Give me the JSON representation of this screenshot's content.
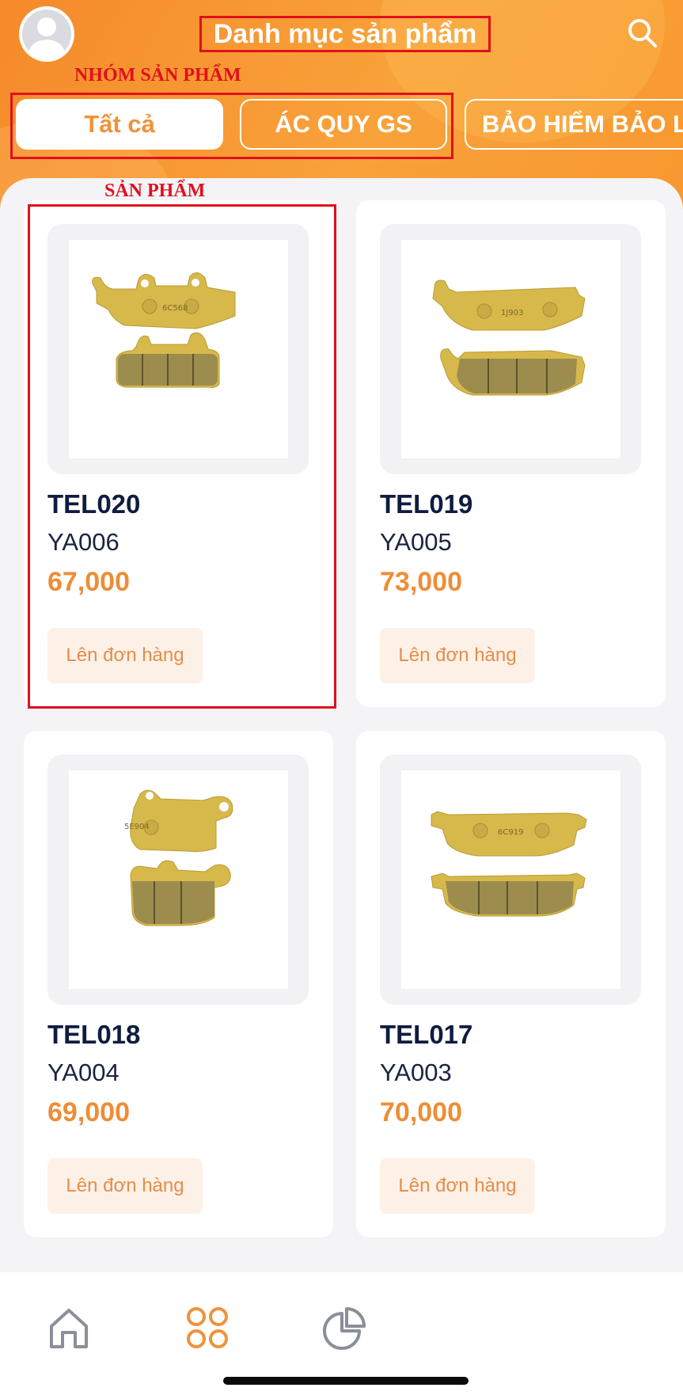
{
  "header": {
    "title": "Danh mục sản phẩm",
    "annotation_group": "NHÓM SẢN PHẨM",
    "annotation_product": "SẢN PHẨM"
  },
  "tabs": [
    {
      "label": "Tất cả",
      "active": true
    },
    {
      "label": "ÁC QUY GS",
      "active": false
    },
    {
      "label": "BẢO HIỂM BẢO L",
      "active": false
    }
  ],
  "products": [
    {
      "code": "TEL020",
      "model": "YA006",
      "price": "67,000",
      "order_label": "Lên đơn hàng",
      "image_text": "6C568"
    },
    {
      "code": "TEL019",
      "model": "YA005",
      "price": "73,000",
      "order_label": "Lên đơn hàng",
      "image_text": "1J903"
    },
    {
      "code": "TEL018",
      "model": "YA004",
      "price": "69,000",
      "order_label": "Lên đơn hàng",
      "image_text": "5E904"
    },
    {
      "code": "TEL017",
      "model": "YA003",
      "price": "70,000",
      "order_label": "Lên đơn hàng",
      "image_text": "6C919"
    }
  ],
  "nav": [
    {
      "icon": "home-icon",
      "active": false
    },
    {
      "icon": "grid-icon",
      "active": true
    },
    {
      "icon": "pie-chart-icon",
      "active": false
    }
  ],
  "colors": {
    "accent": "#f58a2a",
    "price": "#ee8d36",
    "annotation": "#e0101e",
    "pad_metal": "#d7b84b",
    "pad_friction": "#9c8c4e"
  }
}
